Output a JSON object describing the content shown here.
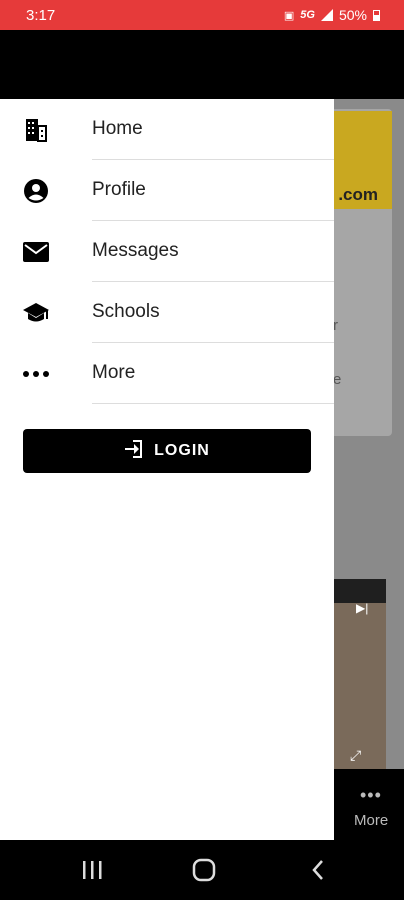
{
  "status_bar": {
    "time": "3:17",
    "network": "5G",
    "battery": "50%"
  },
  "background": {
    "ad_text": ".com",
    "card_fragments": [
      "r",
      "e"
    ],
    "more_label": "More"
  },
  "drawer": {
    "items": [
      {
        "label": "Home",
        "icon": "building-icon"
      },
      {
        "label": "Profile",
        "icon": "account-circle-icon"
      },
      {
        "label": "Messages",
        "icon": "mail-icon"
      },
      {
        "label": "Schools",
        "icon": "school-icon"
      },
      {
        "label": "More",
        "icon": "more-horizontal-icon"
      }
    ],
    "login_label": "LOGIN"
  },
  "colors": {
    "status_bar": "#e63a3a",
    "header": "#000000",
    "drawer_bg": "#ffffff",
    "login_bg": "#000000"
  }
}
